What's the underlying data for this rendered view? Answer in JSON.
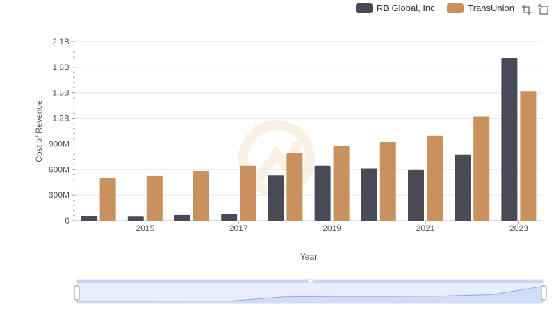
{
  "chart_data": {
    "type": "bar",
    "xlabel": "Year",
    "ylabel": "Cost of Revenue",
    "categories": [
      "2014",
      "2015",
      "2016",
      "2017",
      "2018",
      "2019",
      "2020",
      "2021",
      "2022",
      "2023"
    ],
    "x_tick_labels": [
      "2015",
      "2017",
      "2019",
      "2021",
      "2023"
    ],
    "y_tick_labels": [
      "0",
      "300M",
      "600M",
      "900M",
      "1.2B",
      "1.5B",
      "1.8B",
      "2.1B"
    ],
    "y_ticks": [
      0,
      300000000,
      600000000,
      900000000,
      1200000000,
      1500000000,
      1800000000,
      2100000000
    ],
    "ylim": [
      0,
      2100000000
    ],
    "grid": true,
    "legend_position": "top-right",
    "series": [
      {
        "name": "RB Global, Inc.",
        "color": "#4a4a56",
        "values": [
          57000000,
          55000000,
          66000000,
          80000000,
          535000000,
          645000000,
          615000000,
          595000000,
          775000000,
          1905000000
        ]
      },
      {
        "name": "TransUnion",
        "color": "#c9915e",
        "values": [
          497000000,
          530000000,
          580000000,
          645000000,
          790000000,
          875000000,
          920000000,
          995000000,
          1225000000,
          1520000000
        ]
      }
    ]
  },
  "range_selector": {
    "overview_values": [
      0.05,
      0.05,
      0.06,
      0.07,
      0.3,
      0.33,
      0.33,
      0.35,
      0.44,
      0.95
    ]
  },
  "toolbar": {
    "icons": [
      "zoom-select-icon",
      "reset-zoom-icon"
    ]
  }
}
